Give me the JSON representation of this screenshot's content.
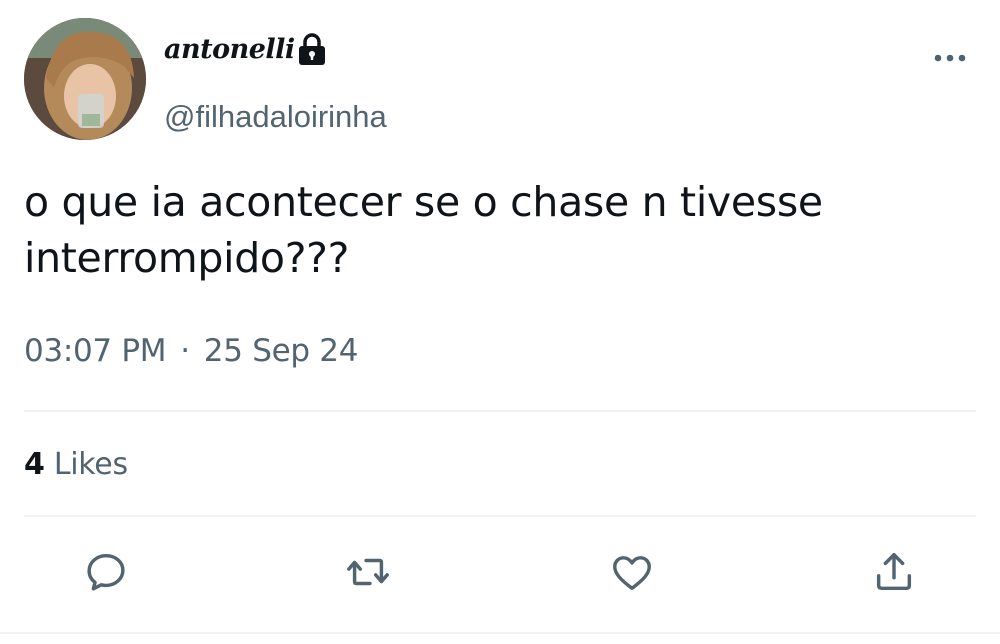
{
  "author": {
    "display_name": "antonelli",
    "handle": "@filhadaloirinha",
    "protected": true
  },
  "tweet": {
    "text_line_1": "o que ia acontecer se o chase n tivesse",
    "text_line_2": "interrompido???",
    "time": "03:07 PM",
    "separator": "·",
    "date": "25 Sep 24"
  },
  "stats": {
    "likes_count": "4",
    "likes_label": "Likes"
  },
  "actions": [
    "reply-icon",
    "retweet-icon",
    "like-icon",
    "share-icon"
  ],
  "colors": {
    "text_primary": "#0f1419",
    "text_secondary": "#536471",
    "divider": "#eff3f4",
    "icon": "#536471"
  }
}
